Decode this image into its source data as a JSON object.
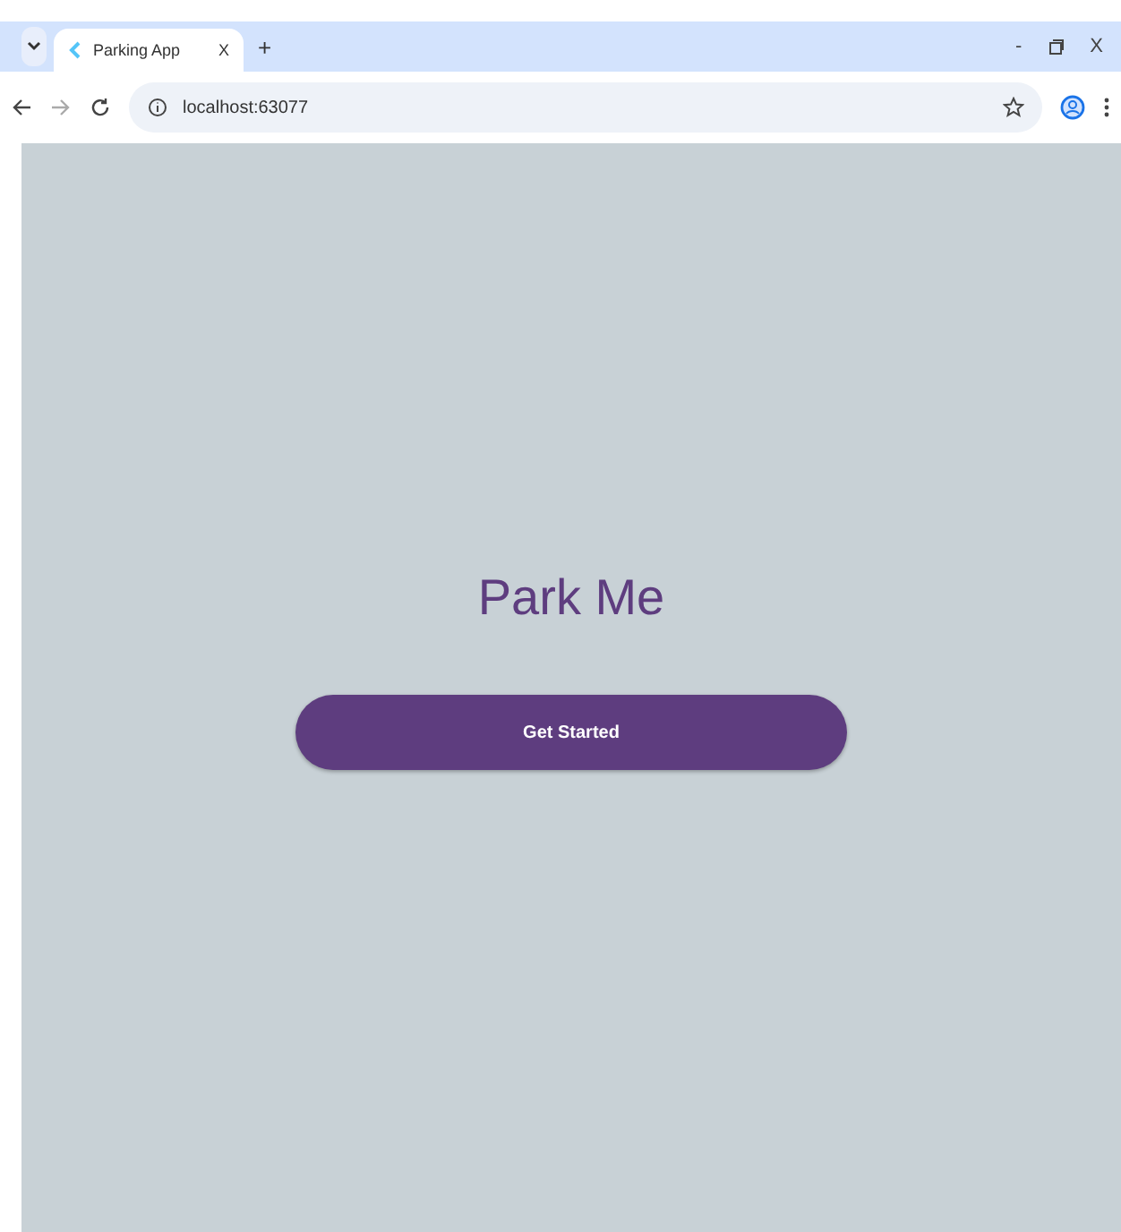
{
  "browser": {
    "tabs": [
      {
        "title": "Parking App",
        "close": "X",
        "selected": true
      }
    ],
    "new_tab": "+",
    "window_controls": {
      "minimize": "-",
      "close": "X"
    },
    "address": "localhost:63077"
  },
  "page": {
    "title": "Park Me",
    "button": "Get Started"
  }
}
